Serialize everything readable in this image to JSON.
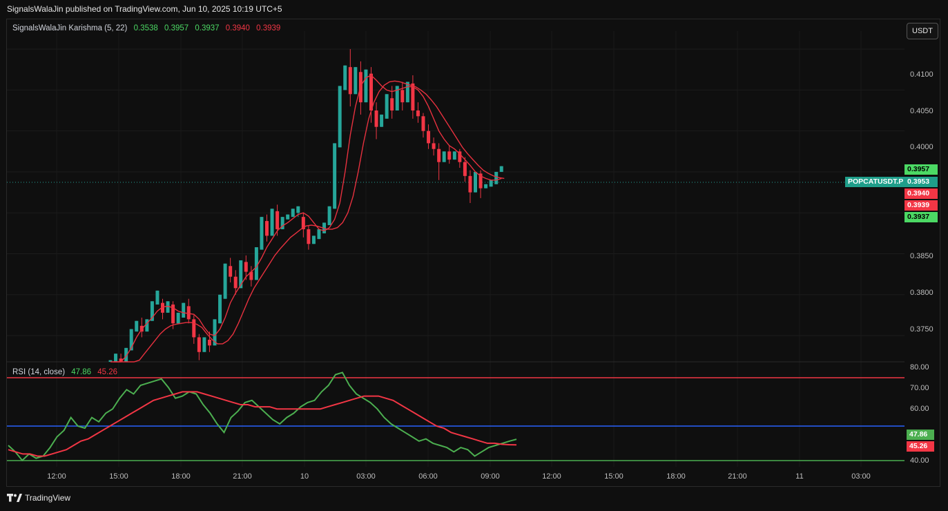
{
  "header": {
    "title": "SignalsWalaJin published on TradingView.com, Jun 10, 2025 10:19 UTC+5"
  },
  "legend": {
    "name": "SignalsWalaJin Karishma (5, 22)",
    "v1": "0.3538",
    "v2": "0.3957",
    "v3": "0.3937",
    "v4": "0.3940",
    "v5": "0.3939"
  },
  "rsi_legend": {
    "name": "RSI (14, close)",
    "v1": "47.86",
    "v2": "45.26"
  },
  "currency_button": "USDT",
  "symbol_tag": "POPCATUSDT.P",
  "price_tags": {
    "p3957": "0.3957",
    "p3953": "0.3953",
    "p3940": "0.3940",
    "p3939": "0.3939",
    "p3937": "0.3937"
  },
  "rsi_tags": {
    "r1": "47.86",
    "r2": "45.26"
  },
  "y_labels": [
    "0.4100",
    "0.4050",
    "0.4000",
    "0.3850",
    "0.3800",
    "0.3750"
  ],
  "rsi_y_labels": [
    "80.00",
    "70.00",
    "60.00",
    "40.00"
  ],
  "x_labels": [
    "12:00",
    "15:00",
    "18:00",
    "21:00",
    "10",
    "03:00",
    "06:00",
    "09:00",
    "12:00",
    "15:00",
    "18:00",
    "21:00",
    "11",
    "03:00"
  ],
  "footer": {
    "brand": "TradingView"
  },
  "colors": {
    "bull": "#26a69a",
    "bear": "#f23645",
    "ma": "#e8313f",
    "rsi": "#4caf50",
    "rsi_ma": "#f23645",
    "upper_band": "#f23645",
    "mid_band": "#2962ff",
    "lower_band": "#4caf50"
  },
  "chart_data": [
    {
      "type": "candlestick",
      "symbol": "POPCATUSDT.P",
      "ylim": [
        0.3718,
        0.4122
      ],
      "last_price": 0.3953,
      "candles": [
        [
          0.371,
          0.372,
          0.3702,
          0.3718
        ],
        [
          0.3718,
          0.3728,
          0.371,
          0.3722
        ],
        [
          0.3722,
          0.3715,
          0.3728,
          0.371
        ],
        [
          0.3715,
          0.3735,
          0.3712,
          0.3732
        ],
        [
          0.3732,
          0.3758,
          0.3728,
          0.3755
        ],
        [
          0.3755,
          0.3768,
          0.3745,
          0.3762
        ],
        [
          0.3762,
          0.3755,
          0.3772,
          0.3748
        ],
        [
          0.3755,
          0.377,
          0.3752,
          0.3768
        ],
        [
          0.3768,
          0.3792,
          0.376,
          0.3788
        ],
        [
          0.3788,
          0.3805,
          0.378,
          0.379
        ],
        [
          0.379,
          0.3778,
          0.3795,
          0.377
        ],
        [
          0.3778,
          0.3792,
          0.377,
          0.3788
        ],
        [
          0.3788,
          0.3765,
          0.3792,
          0.3758
        ],
        [
          0.3765,
          0.3778,
          0.376,
          0.3772
        ],
        [
          0.3772,
          0.379,
          0.3768,
          0.3786
        ],
        [
          0.3786,
          0.377,
          0.3795,
          0.3765
        ],
        [
          0.377,
          0.3748,
          0.3775,
          0.374
        ],
        [
          0.3748,
          0.373,
          0.3752,
          0.372
        ],
        [
          0.373,
          0.3748,
          0.3725,
          0.3745
        ],
        [
          0.3745,
          0.3738,
          0.3755,
          0.373
        ],
        [
          0.3738,
          0.377,
          0.3735,
          0.3765
        ],
        [
          0.3765,
          0.38,
          0.376,
          0.3795
        ],
        [
          0.3795,
          0.3838,
          0.379,
          0.3835
        ],
        [
          0.3835,
          0.3822,
          0.3845,
          0.3815
        ],
        [
          0.3822,
          0.3808,
          0.383,
          0.38
        ],
        [
          0.3808,
          0.3842,
          0.3805,
          0.384
        ],
        [
          0.384,
          0.3828,
          0.3848,
          0.3818
        ],
        [
          0.3828,
          0.3818,
          0.3835,
          0.381
        ],
        [
          0.3818,
          0.3858,
          0.3815,
          0.3855
        ],
        [
          0.3855,
          0.3895,
          0.385,
          0.389
        ],
        [
          0.389,
          0.3872,
          0.3898,
          0.3865
        ],
        [
          0.3872,
          0.3905,
          0.387,
          0.3902
        ],
        [
          0.3902,
          0.388,
          0.391,
          0.3872
        ],
        [
          0.388,
          0.3895,
          0.3875,
          0.3892
        ],
        [
          0.3892,
          0.3898,
          0.3885,
          0.3895
        ],
        [
          0.3895,
          0.3905,
          0.3888,
          0.39
        ],
        [
          0.39,
          0.3908,
          0.3895,
          0.3895
        ],
        [
          0.3895,
          0.388,
          0.39,
          0.387
        ],
        [
          0.388,
          0.3862,
          0.3885,
          0.3855
        ],
        [
          0.3862,
          0.3872,
          0.3858,
          0.3868
        ],
        [
          0.3868,
          0.388,
          0.3862,
          0.3875
        ],
        [
          0.3875,
          0.3888,
          0.387,
          0.3885
        ],
        [
          0.3885,
          0.3908,
          0.388,
          0.3905
        ],
        [
          0.3905,
          0.3985,
          0.39,
          0.398
        ],
        [
          0.398,
          0.4055,
          0.3975,
          0.405
        ],
        [
          0.405,
          0.408,
          0.404,
          0.4078
        ],
        [
          0.4078,
          0.4045,
          0.41,
          0.403
        ],
        [
          0.4045,
          0.4078,
          0.404,
          0.4072
        ],
        [
          0.4072,
          0.4035,
          0.4085,
          0.402
        ],
        [
          0.4035,
          0.4075,
          0.403,
          0.407
        ],
        [
          0.407,
          0.4025,
          0.4078,
          0.401
        ],
        [
          0.4025,
          0.4005,
          0.4035,
          0.399
        ],
        [
          0.4005,
          0.402,
          0.3995,
          0.4015
        ],
        [
          0.4015,
          0.4045,
          0.401,
          0.404
        ],
        [
          0.404,
          0.4025,
          0.4055,
          0.4015
        ],
        [
          0.4025,
          0.4055,
          0.4018,
          0.405
        ],
        [
          0.405,
          0.4035,
          0.406,
          0.4025
        ],
        [
          0.4035,
          0.406,
          0.403,
          0.4058
        ],
        [
          0.4058,
          0.4025,
          0.4068,
          0.4015
        ],
        [
          0.4025,
          0.4018,
          0.4035,
          0.401
        ],
        [
          0.4018,
          0.4,
          0.4022,
          0.3992
        ],
        [
          0.4,
          0.3985,
          0.4008,
          0.3978
        ],
        [
          0.3985,
          0.3978,
          0.3992,
          0.397
        ],
        [
          0.3978,
          0.3962,
          0.3985,
          0.394
        ],
        [
          0.3962,
          0.3975,
          0.3958,
          0.3972
        ],
        [
          0.3975,
          0.3965,
          0.3982,
          0.396
        ],
        [
          0.3965,
          0.3975,
          0.396,
          0.3972
        ],
        [
          0.3975,
          0.3962,
          0.3978,
          0.3955
        ],
        [
          0.3962,
          0.3945,
          0.3968,
          0.3938
        ],
        [
          0.3945,
          0.3925,
          0.3952,
          0.3912
        ],
        [
          0.3925,
          0.395,
          0.392,
          0.3948
        ],
        [
          0.3948,
          0.393,
          0.3952,
          0.3918
        ],
        [
          0.393,
          0.3935,
          0.3925,
          0.3932
        ],
        [
          0.3932,
          0.394,
          0.3925,
          0.3935
        ],
        [
          0.3935,
          0.395,
          0.393,
          0.3955
        ],
        [
          0.395,
          0.3957,
          0.3945,
          0.3953
        ]
      ],
      "ma_fast": [
        0.37,
        0.371,
        0.3718,
        0.3725,
        0.3735,
        0.3748,
        0.3758,
        0.3765,
        0.3772,
        0.378,
        0.3785,
        0.3786,
        0.3784,
        0.378,
        0.3778,
        0.3777,
        0.3776,
        0.377,
        0.376,
        0.3752,
        0.375,
        0.3758,
        0.3772,
        0.379,
        0.3802,
        0.3812,
        0.3822,
        0.3828,
        0.3834,
        0.3845,
        0.3858,
        0.3868,
        0.3878,
        0.3884,
        0.3888,
        0.3893,
        0.3898,
        0.39,
        0.3896,
        0.3888,
        0.388,
        0.3878,
        0.3882,
        0.3892,
        0.3912,
        0.395,
        0.3995,
        0.403,
        0.4055,
        0.4065,
        0.4068,
        0.4062,
        0.4055,
        0.405,
        0.4048,
        0.405,
        0.4052,
        0.4054,
        0.4054,
        0.405,
        0.4042,
        0.403,
        0.4015,
        0.4,
        0.399,
        0.3982,
        0.3978,
        0.3972,
        0.3965,
        0.3958,
        0.395,
        0.3945,
        0.3942,
        0.394,
        0.394,
        0.3942
      ],
      "ma_slow": [
        0.369,
        0.3695,
        0.37,
        0.3705,
        0.3712,
        0.372,
        0.3728,
        0.3736,
        0.3744,
        0.3752,
        0.3758,
        0.3762,
        0.3764,
        0.3765,
        0.3766,
        0.3766,
        0.3764,
        0.376,
        0.3752,
        0.3745,
        0.374,
        0.374,
        0.3744,
        0.3752,
        0.3765,
        0.378,
        0.3795,
        0.3808,
        0.3818,
        0.3828,
        0.3838,
        0.3848,
        0.3856,
        0.3863,
        0.387,
        0.3875,
        0.388,
        0.3884,
        0.3885,
        0.3884,
        0.3882,
        0.388,
        0.388,
        0.3882,
        0.3888,
        0.39,
        0.392,
        0.395,
        0.3985,
        0.4015,
        0.4035,
        0.4048,
        0.4056,
        0.406,
        0.4061,
        0.406,
        0.4058,
        0.4056,
        0.4054,
        0.405,
        0.4045,
        0.4038,
        0.403,
        0.402,
        0.401,
        0.4,
        0.399,
        0.398,
        0.3972,
        0.3965,
        0.3958,
        0.3952,
        0.3948,
        0.3945,
        0.3943,
        0.3942
      ]
    },
    {
      "type": "line",
      "title": "RSI (14, close)",
      "ylim": [
        35,
        83
      ],
      "levels": {
        "upper": 75,
        "middle": 52,
        "lower": 37.5
      },
      "rsi": [
        45,
        42,
        38,
        41,
        39,
        40,
        44,
        49,
        52,
        58,
        54,
        53,
        58,
        56,
        60,
        62,
        67,
        71,
        69,
        73,
        74,
        75,
        76,
        72,
        67,
        68,
        70,
        69,
        64,
        60,
        55,
        51,
        58,
        61,
        65,
        66,
        63,
        60,
        57,
        55,
        58,
        60,
        63,
        65,
        66,
        70,
        73,
        78,
        79,
        73,
        69,
        67,
        65,
        62,
        58,
        55,
        53,
        51,
        49,
        47,
        48,
        46,
        45,
        44,
        42,
        44,
        43,
        40,
        42,
        44,
        45,
        46,
        47,
        47.86
      ],
      "rsi_ma": [
        43,
        42,
        41,
        41,
        40,
        40,
        41,
        42,
        43,
        45,
        47,
        48,
        50,
        52,
        54,
        56,
        58,
        60,
        62,
        64,
        66,
        67,
        68,
        69,
        70,
        70,
        70,
        69,
        68,
        67,
        66,
        65,
        64,
        64,
        63,
        63,
        63,
        62,
        62,
        62,
        62,
        62,
        62,
        62,
        63,
        64,
        65,
        66,
        67,
        68,
        68,
        68,
        67,
        66,
        64,
        62,
        60,
        58,
        56,
        54,
        53,
        51,
        50,
        49,
        48,
        47,
        46,
        46,
        45.5,
        45.3,
        45.26
      ]
    }
  ]
}
